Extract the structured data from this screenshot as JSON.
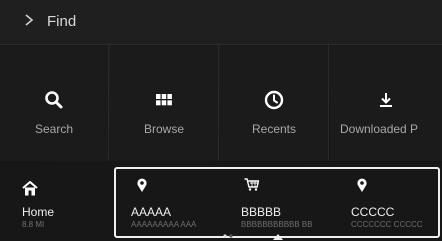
{
  "header": {
    "title": "Find"
  },
  "tiles": [
    {
      "label": "Search",
      "icon": "search-icon"
    },
    {
      "label": "Browse",
      "icon": "grid-icon"
    },
    {
      "label": "Recents",
      "icon": "clock-icon"
    },
    {
      "label": "Downloaded P",
      "icon": "download-icon"
    }
  ],
  "home": {
    "name": "Home",
    "distance": "8.8 MI"
  },
  "cards": [
    {
      "name": "AAAAA",
      "sub": "AAAAAAAAA AAA",
      "icon": "pin-icon"
    },
    {
      "name": "BBBBB",
      "sub": "BBBBBBBBBBB BB",
      "icon": "cart-icon"
    },
    {
      "name": "CCCCC",
      "sub": "CCCCCCC CCCCC",
      "icon": "pin-icon"
    }
  ]
}
